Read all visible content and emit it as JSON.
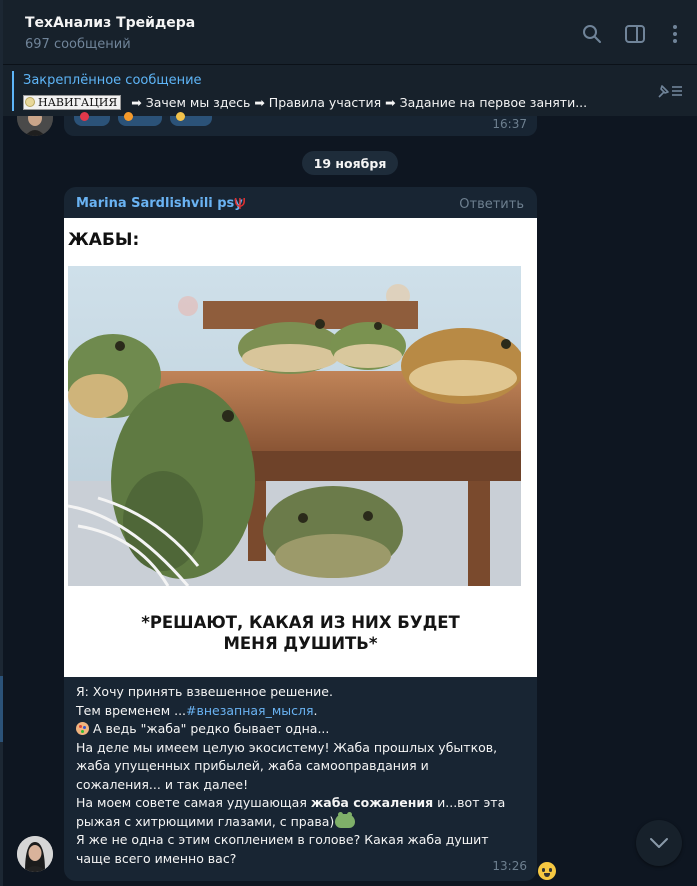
{
  "header": {
    "title": "ТехАнализ Трейдера",
    "subtitle": "697 сообщений",
    "icons": [
      "search-icon",
      "sidebar-toggle-icon",
      "more-vertical-icon"
    ]
  },
  "pinned": {
    "title": "Закреплённое сообщение",
    "badge": "НАВИГАЦИЯ",
    "text": "➡ Зачем мы здесь ➡ Правила участия ➡ Задание на первое заняти...",
    "icon": "unpin-icon"
  },
  "previous_message": {
    "time": "16:37"
  },
  "date_separator": "19 ноября",
  "message": {
    "sender": "Marina Sardlishvili psy",
    "sender_badge": "Ψ",
    "reply_label": "Ответить",
    "meme_title": "ЖАБЫ:",
    "meme_caption_line1": "*РЕШАЮТ, КАКАЯ ИЗ НИХ БУДЕТ",
    "meme_caption_line2": "МЕНЯ ДУШИТЬ*",
    "lines": {
      "l1": "Я: Хочу принять взвешенное решение.",
      "l2_prefix": "Тем временем ...",
      "l2_tag": "#внезапная_мысля",
      "l2_suffix": ".",
      "l3": "А ведь \"жаба\"  редко бывает одна...",
      "l4": "На деле мы имеем целую экосистему! Жаба прошлых убытков,",
      "l5": "жаба  упущенных прибылей, жаба самооправдания и",
      "l6": "сожаления... и так далее!",
      "l7_prefix": "На моем совете самая удушающая ",
      "l7_bold": "жаба сожаления",
      "l7_suffix": " и...вот эта",
      "l8": "рыжая с хитрющими глазами, с права)",
      "l9": "Я же не одна с этим скоплением в голове? Какая жаба душит",
      "l10": "чаще всего именно вас?"
    },
    "time": "13:26"
  },
  "colors": {
    "background": "#0e1621",
    "panel": "#17212b",
    "bubble": "#182533",
    "accent": "#5eb5f7",
    "link": "#6ab3f3",
    "muted": "#6d7f8f"
  }
}
